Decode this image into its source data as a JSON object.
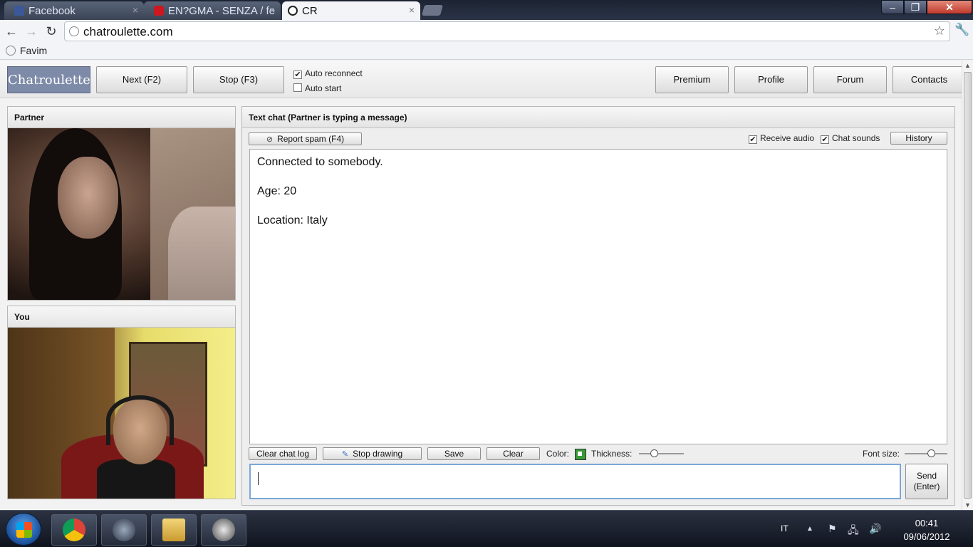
{
  "browser": {
    "tabs": [
      {
        "title": "Facebook",
        "favicon": "facebook-icon",
        "color": "#3b5998"
      },
      {
        "title": "EN?GMA - SENZA / fe",
        "favicon": "youtube-icon",
        "color": "#cc181e"
      },
      {
        "title": "CR",
        "favicon": "chatroulette-icon",
        "color": "#222222"
      }
    ],
    "url": "chatroulette.com",
    "bookmarks": [
      {
        "label": "Favim"
      }
    ]
  },
  "header": {
    "logo": "Chatroulette",
    "next_label": "Next (F2)",
    "stop_label": "Stop (F3)",
    "auto_reconnect": {
      "label": "Auto reconnect",
      "checked": true
    },
    "auto_start": {
      "label": "Auto start",
      "checked": false
    },
    "nav": [
      "Premium",
      "Profile",
      "Forum",
      "Contacts"
    ]
  },
  "partner_panel": {
    "title": "Partner"
  },
  "you_panel": {
    "title": "You"
  },
  "chat": {
    "title": "Text chat (Partner is typing a message)",
    "report_spam": "Report spam (F4)",
    "receive_audio": {
      "label": "Receive audio",
      "checked": true
    },
    "chat_sounds": {
      "label": "Chat sounds",
      "checked": true
    },
    "history": "History",
    "messages": [
      "Connected to somebody.",
      "Age: 20",
      "Location: Italy"
    ],
    "clear_chat_log": "Clear chat log",
    "stop_drawing": "Stop drawing",
    "save": "Save",
    "clear": "Clear",
    "color_label": "Color:",
    "drawing_color": "#3a9a3a",
    "thickness_label": "Thickness:",
    "thickness_level": 0.3,
    "font_size_label": "Font size:",
    "font_size_level": 0.65,
    "send_line1": "Send",
    "send_line2": "(Enter)",
    "input_value": ""
  },
  "taskbar": {
    "apps": [
      "chrome-icon",
      "teamspeak-icon",
      "folder-icon",
      "steam-icon"
    ],
    "language": "IT",
    "time": "00:41",
    "date": "09/06/2012"
  }
}
